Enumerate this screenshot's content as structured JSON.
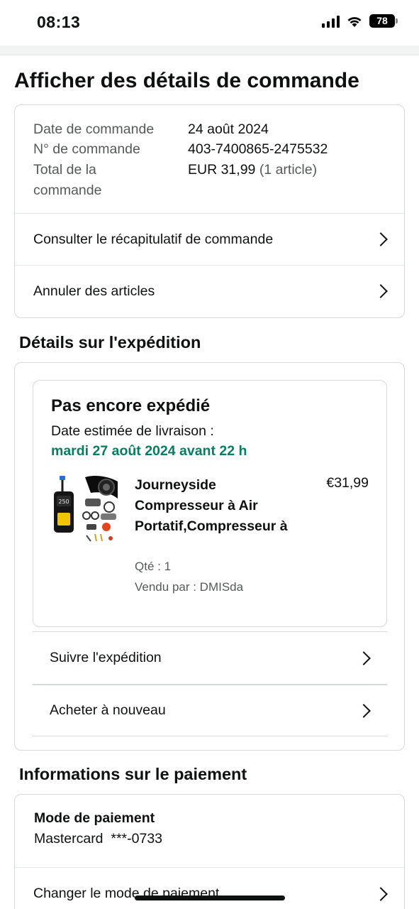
{
  "status_bar": {
    "time": "08:13",
    "battery": "78"
  },
  "page": {
    "title": "Afficher des détails de commande"
  },
  "order_summary": {
    "date_label": "Date de commande",
    "date_value": "24 août 2024",
    "number_label": "N° de commande",
    "number_value": "403-7400865-2475532",
    "total_label_line1": "Total de la",
    "total_label_line2": "commande",
    "total_value": "EUR 31,99",
    "total_count": "(1 article)",
    "recap_link": "Consulter le récapitulatif de commande",
    "cancel_link": "Annuler des articles"
  },
  "shipment": {
    "section_title": "Détails sur l'expédition",
    "status": "Pas encore expédié",
    "delivery_label": "Date estimée de livraison :",
    "delivery_date": "mardi 27 août 2024 avant 22 h",
    "product": {
      "title": "Journeyside Compresseur à Air Portatif,Compresseur à",
      "price": "€31,99",
      "quantity": "Qté : 1",
      "seller": "Vendu par : DMISda",
      "image_screen_text": "250"
    },
    "track_link": "Suivre l'expédition",
    "buy_again_link": "Acheter à nouveau"
  },
  "payment": {
    "section_title": "Informations sur le paiement",
    "method_label": "Mode de paiement",
    "method_value": "Mastercard  ***-0733",
    "change_link": "Changer le mode de paiement"
  },
  "colors": {
    "delivery_green": "#067d62",
    "text": "#0f1111",
    "muted": "#565959",
    "border": "#d5d9d9"
  }
}
